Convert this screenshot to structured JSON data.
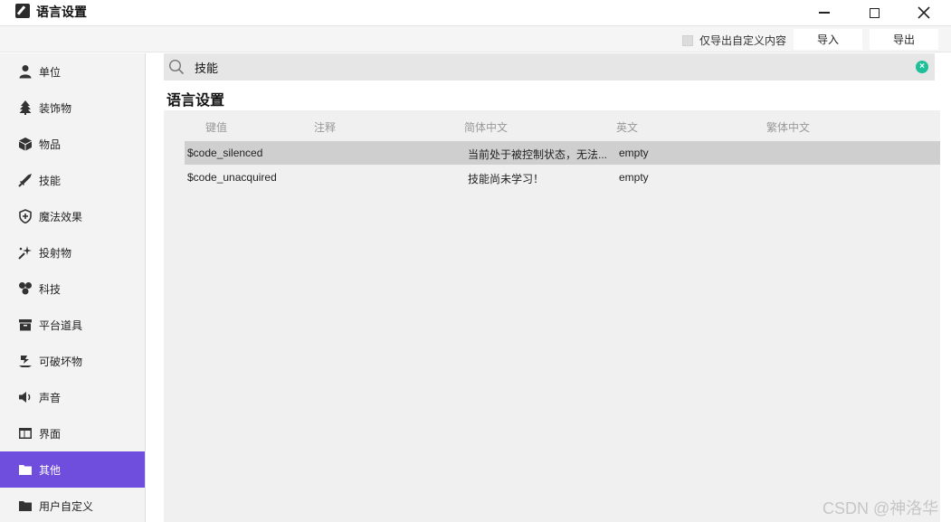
{
  "window": {
    "title": "语言设置",
    "app_icon": "brush-icon"
  },
  "toolbar": {
    "checkbox_label": "仅导出自定义内容",
    "checkbox_checked": false,
    "import_label": "导入",
    "export_label": "导出"
  },
  "sidebar": {
    "items": [
      {
        "label": "单位",
        "icon": "person-icon",
        "active": false
      },
      {
        "label": "装饰物",
        "icon": "tree-icon",
        "active": false
      },
      {
        "label": "物品",
        "icon": "cube-icon",
        "active": false
      },
      {
        "label": "技能",
        "icon": "sword-icon",
        "active": false
      },
      {
        "label": "魔法效果",
        "icon": "shield-icon",
        "active": false
      },
      {
        "label": "投射物",
        "icon": "sparkle-icon",
        "active": false
      },
      {
        "label": "科技",
        "icon": "hexagons-icon",
        "active": false
      },
      {
        "label": "平台道具",
        "icon": "archive-icon",
        "active": false
      },
      {
        "label": "可破坏物",
        "icon": "debris-icon",
        "active": false
      },
      {
        "label": "声音",
        "icon": "speaker-icon",
        "active": false
      },
      {
        "label": "界面",
        "icon": "window-icon",
        "active": false
      },
      {
        "label": "其他",
        "icon": "folder-icon",
        "active": true
      },
      {
        "label": "用户自定义",
        "icon": "folder-icon",
        "active": false
      }
    ],
    "accent_color": "#6f4ddd"
  },
  "search": {
    "value": "技能",
    "placeholder": ""
  },
  "main": {
    "section_title": "语言设置",
    "columns": [
      "键值",
      "注释",
      "简体中文",
      "英文",
      "繁体中文"
    ],
    "rows": [
      {
        "key": "$code_silenced",
        "note": "",
        "zh_cn": "当前处于被控制状态，无法...",
        "en": "empty",
        "zh_tw": "",
        "selected": true
      },
      {
        "key": "$code_unacquired",
        "note": "",
        "zh_cn": "技能尚未学习！",
        "en": "empty",
        "zh_tw": "",
        "selected": false
      }
    ]
  },
  "watermark": "CSDN @神洛华"
}
